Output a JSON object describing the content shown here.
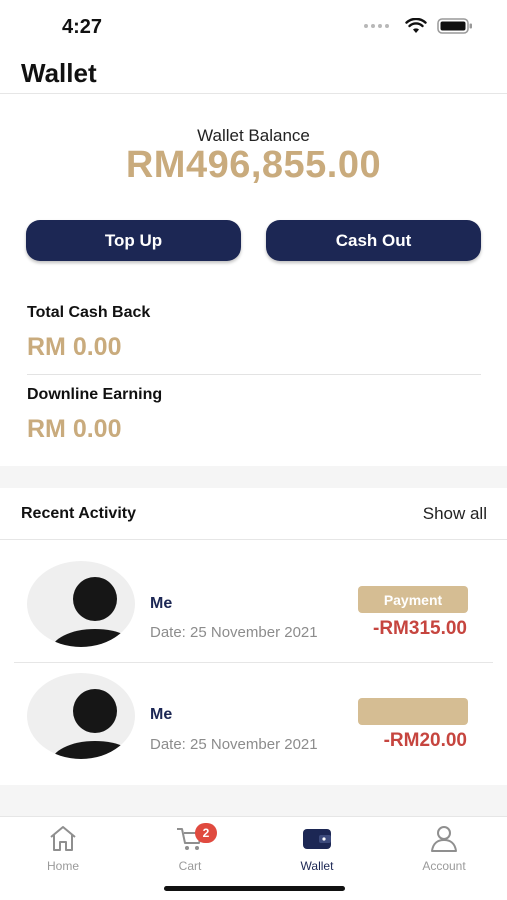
{
  "status_bar": {
    "time": "4:27"
  },
  "header": {
    "title": "Wallet"
  },
  "balance": {
    "label": "Wallet Balance",
    "amount": "RM496,855.00"
  },
  "actions": {
    "top_up_label": "Top Up",
    "cash_out_label": "Cash Out"
  },
  "stats": [
    {
      "label": "Total Cash Back",
      "value": "RM 0.00"
    },
    {
      "label": "Downline Earning",
      "value": "RM 0.00"
    }
  ],
  "recent_activity": {
    "title": "Recent Activity",
    "show_all_label": "Show all",
    "items": [
      {
        "name": "Me",
        "date": "Date: 25 November 2021",
        "badge": "Payment",
        "amount": "-RM315.00"
      },
      {
        "name": "Me",
        "date": "Date: 25 November 2021",
        "badge": "",
        "amount": "-RM20.00"
      }
    ]
  },
  "tab_bar": {
    "items": [
      {
        "label": "Home",
        "icon": "home-icon"
      },
      {
        "label": "Cart",
        "icon": "cart-icon",
        "badge": "2"
      },
      {
        "label": "Wallet",
        "icon": "wallet-icon",
        "active": true
      },
      {
        "label": "Account",
        "icon": "person-icon"
      }
    ]
  },
  "colors": {
    "accent_gold": "#c9ab7d",
    "badge_gold": "#d5bd93",
    "navy": "#1c2754",
    "negative_red": "#c6453f",
    "cart_badge_red": "#e04a3f"
  }
}
